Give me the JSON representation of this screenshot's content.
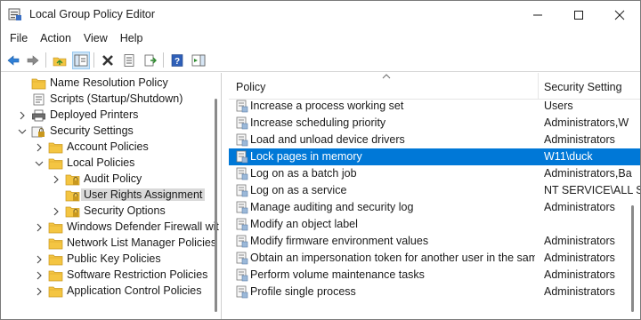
{
  "window": {
    "title": "Local Group Policy Editor"
  },
  "menu": {
    "items": [
      "File",
      "Action",
      "View",
      "Help"
    ]
  },
  "tree": {
    "items": [
      {
        "label": "Name Resolution Policy",
        "level": 1,
        "expander": "none",
        "icon": "folder-icon"
      },
      {
        "label": "Scripts (Startup/Shutdown)",
        "level": 1,
        "expander": "none",
        "icon": "script-icon"
      },
      {
        "label": "Deployed Printers",
        "level": 1,
        "expander": "collapsed",
        "icon": "printer-icon"
      },
      {
        "label": "Security Settings",
        "level": 1,
        "expander": "expanded",
        "icon": "security-icon"
      },
      {
        "label": "Account Policies",
        "level": 2,
        "expander": "collapsed",
        "icon": "folder-icon"
      },
      {
        "label": "Local Policies",
        "level": 2,
        "expander": "expanded",
        "icon": "folder-icon"
      },
      {
        "label": "Audit Policy",
        "level": 3,
        "expander": "collapsed",
        "icon": "folder-lock-icon"
      },
      {
        "label": "User Rights Assignment",
        "level": 3,
        "expander": "none",
        "icon": "folder-lock-icon",
        "selected": true
      },
      {
        "label": "Security Options",
        "level": 3,
        "expander": "collapsed",
        "icon": "folder-lock-icon"
      },
      {
        "label": "Windows Defender Firewall wit",
        "level": 2,
        "expander": "collapsed",
        "icon": "folder-icon"
      },
      {
        "label": "Network List Manager Policies",
        "level": 2,
        "expander": "none",
        "icon": "folder-icon"
      },
      {
        "label": "Public Key Policies",
        "level": 2,
        "expander": "collapsed",
        "icon": "folder-icon"
      },
      {
        "label": "Software Restriction Policies",
        "level": 2,
        "expander": "collapsed",
        "icon": "folder-icon"
      },
      {
        "label": "Application Control Policies",
        "level": 2,
        "expander": "collapsed",
        "icon": "folder-icon"
      }
    ]
  },
  "list": {
    "columns": {
      "policy": "Policy",
      "setting": "Security Setting"
    },
    "rows": [
      {
        "policy": "Increase a process working set",
        "setting": "Users"
      },
      {
        "policy": "Increase scheduling priority",
        "setting": "Administrators,W"
      },
      {
        "policy": "Load and unload device drivers",
        "setting": "Administrators"
      },
      {
        "policy": "Lock pages in memory",
        "setting": "W11\\duck",
        "selected": true
      },
      {
        "policy": "Log on as a batch job",
        "setting": "Administrators,Ba"
      },
      {
        "policy": "Log on as a service",
        "setting": "NT SERVICE\\ALL S"
      },
      {
        "policy": "Manage auditing and security log",
        "setting": "Administrators"
      },
      {
        "policy": "Modify an object label",
        "setting": ""
      },
      {
        "policy": "Modify firmware environment values",
        "setting": "Administrators"
      },
      {
        "policy": "Obtain an impersonation token for another user in the same...",
        "setting": "Administrators"
      },
      {
        "policy": "Perform volume maintenance tasks",
        "setting": "Administrators"
      },
      {
        "policy": "Profile single process",
        "setting": "Administrators"
      }
    ]
  },
  "colors": {
    "selection": "#0078d7",
    "tree_selection": "#d9d9d9",
    "folder": "#f4c542"
  }
}
